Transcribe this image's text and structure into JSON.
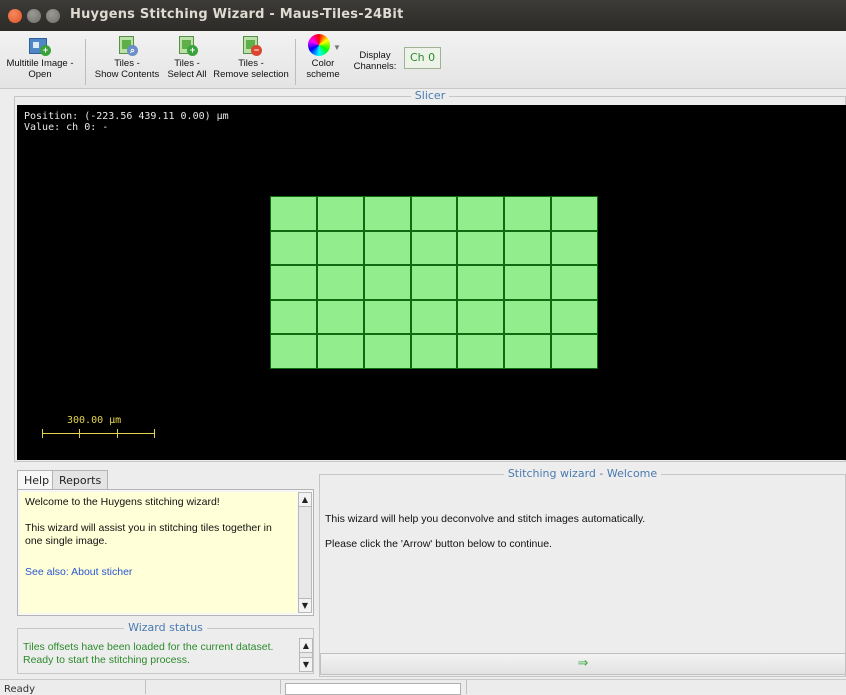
{
  "window": {
    "title": "Huygens Stitching Wizard  - Maus-Tiles-24Bit"
  },
  "toolbar": {
    "open": {
      "line1": "Multitile Image -",
      "line2": "Open"
    },
    "show": {
      "line1": "Tiles -",
      "line2": "Show Contents"
    },
    "select": {
      "line1": "Tiles -",
      "line2": "Select All"
    },
    "remove": {
      "line1": "Tiles -",
      "line2": "Remove selection"
    },
    "color": {
      "line1": "Color",
      "line2": "scheme"
    },
    "display": {
      "line1": "Display",
      "line2": "Channels:"
    },
    "channel": "Ch 0"
  },
  "slicer": {
    "title": "Slicer",
    "position": "Position: (-223.56 439.11 0.00) µm",
    "value": "Value: ch 0: -",
    "scale": "300.00 µm",
    "tiles": {
      "cols": 7,
      "rows": 5,
      "color": "#92ed8d",
      "border": "#0f6b12"
    }
  },
  "tabs": {
    "help": "Help",
    "reports": "Reports"
  },
  "help": {
    "p1": "Welcome to the Huygens stitching wizard!",
    "p2": "This wizard will assist you in stitching tiles together in one single image.",
    "link": "See also: About sticher"
  },
  "status": {
    "title": "Wizard status",
    "line1": "Tiles offsets have been loaded for the current dataset.",
    "line2": "Ready to start the stitching process."
  },
  "wizard": {
    "title": "Stitching wizard - Welcome",
    "p1": "This wizard will help you deconvolve and stitch images automatically.",
    "p2": "Please click the 'Arrow' button below to continue.",
    "next": "⇒"
  },
  "statusbar": {
    "text": "Ready"
  },
  "icons": {
    "open": "multitile-open-icon",
    "show": "tiles-show-icon",
    "select": "tiles-select-icon",
    "remove": "tiles-remove-icon",
    "color": "color-wheel-icon",
    "scroll_up": "▲",
    "scroll_down": "▼"
  }
}
